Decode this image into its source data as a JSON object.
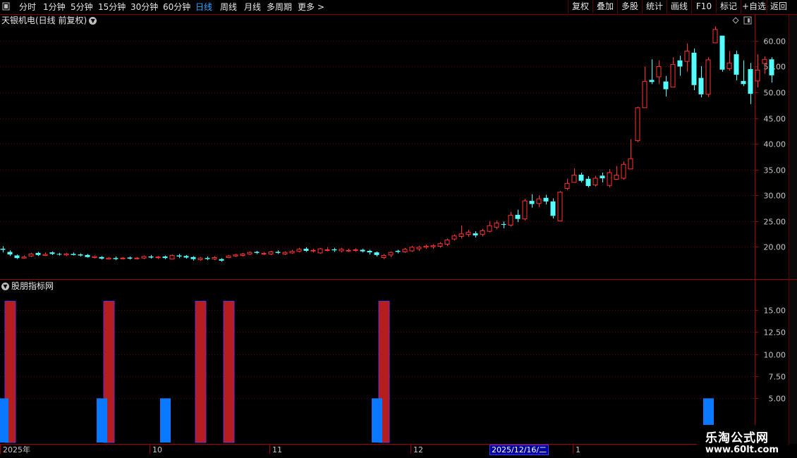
{
  "toolbar": {
    "periods": [
      "分时",
      "1分钟",
      "5分钟",
      "15分钟",
      "30分钟",
      "60分钟",
      "日线",
      "周线",
      "月线",
      "多周期",
      "更多 >"
    ],
    "active_period": "日线",
    "buttons": [
      "复权",
      "叠加",
      "多股",
      "统计",
      "画线",
      "F10",
      "标记",
      "+自选",
      "返回"
    ]
  },
  "main_chart": {
    "stock_title": "天银机电(日线 前复权)",
    "y_ticks": [
      "60.00",
      "55.00",
      "50.00",
      "45.00",
      "40.00",
      "35.00",
      "30.00",
      "25.00",
      "20.00"
    ]
  },
  "sub_chart": {
    "title": "股朋指标网",
    "y_ticks": [
      "15.00",
      "12.50",
      "10.00",
      "7.50",
      "5.00"
    ]
  },
  "x_axis": {
    "labels": [
      "2025年",
      "10",
      "11",
      "12",
      "1"
    ],
    "cursor_date": "2025/12/16/二"
  },
  "watermark": {
    "line1": "乐淘公式网",
    "line2": "www.60lt.com"
  },
  "colors": {
    "up": "#ff3232",
    "down": "#54ffff",
    "grid": "#5a0000",
    "red_bar": "#b41e1e",
    "blue_bar": "#0a78ff",
    "axis_text": "#c8c8c8"
  },
  "chart_data": [
    {
      "type": "candlestick",
      "title": "天银机电(日线 前复权)",
      "ylim": [
        14,
        63
      ],
      "candles": [
        [
          19.6,
          19.4,
          20.1,
          18.9
        ],
        [
          19.0,
          18.5,
          19.3,
          18.2
        ],
        [
          18.3,
          17.8,
          18.5,
          17.6
        ],
        [
          17.8,
          18.0,
          18.3,
          17.7
        ],
        [
          18.2,
          18.6,
          18.8,
          18.0
        ],
        [
          18.8,
          18.4,
          19.0,
          18.2
        ],
        [
          18.3,
          18.5,
          18.9,
          18.2
        ],
        [
          18.9,
          18.6,
          19.1,
          18.4
        ],
        [
          18.6,
          18.5,
          18.8,
          18.3
        ],
        [
          18.4,
          18.6,
          18.8,
          18.2
        ],
        [
          18.6,
          18.4,
          18.9,
          18.3
        ],
        [
          18.5,
          18.3,
          18.7,
          18.1
        ],
        [
          18.4,
          18.0,
          18.6,
          17.9
        ],
        [
          17.9,
          18.1,
          18.3,
          17.7
        ],
        [
          18.0,
          17.7,
          18.2,
          17.5
        ],
        [
          17.6,
          17.8,
          18.0,
          17.5
        ],
        [
          17.8,
          17.6,
          18.1,
          17.4
        ],
        [
          17.7,
          17.8,
          18.0,
          17.5
        ],
        [
          17.9,
          17.7,
          18.1,
          17.5
        ],
        [
          17.7,
          17.8,
          18.0,
          17.5
        ],
        [
          17.8,
          18.1,
          18.3,
          17.6
        ],
        [
          18.1,
          17.9,
          18.4,
          17.7
        ],
        [
          17.9,
          18.0,
          18.2,
          17.6
        ],
        [
          18.1,
          17.8,
          18.3,
          17.6
        ],
        [
          17.6,
          18.3,
          18.5,
          17.5
        ],
        [
          18.3,
          18.1,
          18.6,
          17.8
        ],
        [
          18.2,
          17.9,
          18.4,
          17.7
        ],
        [
          18.0,
          17.6,
          18.2,
          17.3
        ],
        [
          17.5,
          17.8,
          18.0,
          17.3
        ],
        [
          17.8,
          17.6,
          18.1,
          17.4
        ],
        [
          17.6,
          17.9,
          18.2,
          17.4
        ],
        [
          17.6,
          17.3,
          17.8,
          17.1
        ],
        [
          17.9,
          18.2,
          18.4,
          17.8
        ],
        [
          18.2,
          18.4,
          18.6,
          18.0
        ],
        [
          18.3,
          18.6,
          18.8,
          18.1
        ],
        [
          18.6,
          18.9,
          19.1,
          18.4
        ],
        [
          19.0,
          18.8,
          19.2,
          18.6
        ],
        [
          18.7,
          18.7,
          19.0,
          18.4
        ],
        [
          18.6,
          19.0,
          19.2,
          18.4
        ],
        [
          19.0,
          18.8,
          19.3,
          18.6
        ],
        [
          18.6,
          18.9,
          19.1,
          18.4
        ],
        [
          18.8,
          19.1,
          19.4,
          18.6
        ],
        [
          19.1,
          19.5,
          19.8,
          18.9
        ],
        [
          19.6,
          19.2,
          19.9,
          19.0
        ],
        [
          19.2,
          19.3,
          19.6,
          18.9
        ],
        [
          18.8,
          19.6,
          19.8,
          18.6
        ],
        [
          19.4,
          19.4,
          19.9,
          19.1
        ],
        [
          19.5,
          19.3,
          19.8,
          19.0
        ],
        [
          19.2,
          19.5,
          19.8,
          18.9
        ],
        [
          19.3,
          19.3,
          19.6,
          19.0
        ],
        [
          19.3,
          19.4,
          19.7,
          19.0
        ],
        [
          19.4,
          19.1,
          19.6,
          18.9
        ],
        [
          19.2,
          18.9,
          19.4,
          18.5
        ],
        [
          18.9,
          18.4,
          19.1,
          18.1
        ],
        [
          17.9,
          18.3,
          18.6,
          17.6
        ],
        [
          18.4,
          18.9,
          19.1,
          18.0
        ],
        [
          19.2,
          19.0,
          19.4,
          18.7
        ],
        [
          19.0,
          19.5,
          19.8,
          18.8
        ],
        [
          19.2,
          19.9,
          20.2,
          19.0
        ],
        [
          19.6,
          19.9,
          20.2,
          19.2
        ],
        [
          19.9,
          20.1,
          20.4,
          19.6
        ],
        [
          20.0,
          20.2,
          20.5,
          19.6
        ],
        [
          20.1,
          20.6,
          20.9,
          19.8
        ],
        [
          20.5,
          21.3,
          21.6,
          20.1
        ],
        [
          21.5,
          22.1,
          22.4,
          21.2
        ],
        [
          22.0,
          22.5,
          24.1,
          21.6
        ],
        [
          22.4,
          22.8,
          23.3,
          21.9
        ],
        [
          22.6,
          22.2,
          23.0,
          21.8
        ],
        [
          22.4,
          23.1,
          23.5,
          22.0
        ],
        [
          23.0,
          24.1,
          25.0,
          22.8
        ],
        [
          23.8,
          24.6,
          25.1,
          23.4
        ],
        [
          24.4,
          24.3,
          24.9,
          23.6
        ],
        [
          24.2,
          26.1,
          26.8,
          23.9
        ],
        [
          26.2,
          25.4,
          27.2,
          24.8
        ],
        [
          25.4,
          28.9,
          29.3,
          25.1
        ],
        [
          28.9,
          28.3,
          30.2,
          27.6
        ],
        [
          28.4,
          29.3,
          30.0,
          27.7
        ],
        [
          29.5,
          28.8,
          30.1,
          28.2
        ],
        [
          28.8,
          26.0,
          29.4,
          25.5
        ],
        [
          25.0,
          30.6,
          30.8,
          24.9
        ],
        [
          31.3,
          32.3,
          33.2,
          31.0
        ],
        [
          32.5,
          33.9,
          35.2,
          32.6
        ],
        [
          34.0,
          32.8,
          34.4,
          32.5
        ],
        [
          33.2,
          31.8,
          33.7,
          31.5
        ],
        [
          32.0,
          33.3,
          33.8,
          31.7
        ],
        [
          33.8,
          33.3,
          34.4,
          32.5
        ],
        [
          31.9,
          34.4,
          35.1,
          31.5
        ],
        [
          33.1,
          33.9,
          35.7,
          33.0
        ],
        [
          33.3,
          36.0,
          36.6,
          33.0
        ],
        [
          35.1,
          37.1,
          40.9,
          35.1
        ],
        [
          40.6,
          47.0,
          47.2,
          40.3
        ],
        [
          47.0,
          52.1,
          55.0,
          47.0
        ],
        [
          52.4,
          52.0,
          56.4,
          51.6
        ],
        [
          53.0,
          55.0,
          56.2,
          51.6
        ],
        [
          52.1,
          50.6,
          53.2,
          49.2
        ],
        [
          51.0,
          55.4,
          56.8,
          51.0
        ],
        [
          56.2,
          55.0,
          57.1,
          53.2
        ],
        [
          56.0,
          58.0,
          59.5,
          54.0
        ],
        [
          57.7,
          51.4,
          58.5,
          50.4
        ],
        [
          52.8,
          49.6,
          55.1,
          49.0
        ],
        [
          49.6,
          56.3,
          56.8,
          49.1
        ],
        [
          59.6,
          62.2,
          62.8,
          59.6
        ],
        [
          61.0,
          54.4,
          61.0,
          54.0
        ],
        [
          54.6,
          55.7,
          58.0,
          54.2
        ],
        [
          57.4,
          53.4,
          58.1,
          52.3
        ],
        [
          52.2,
          51.6,
          56.2,
          51.2
        ],
        [
          54.5,
          49.7,
          55.7,
          47.7
        ],
        [
          52.2,
          54.3,
          57.4,
          50.9
        ],
        [
          55.6,
          56.4,
          57.0,
          53.6
        ],
        [
          56.4,
          53.3,
          56.8,
          51.9
        ]
      ]
    },
    {
      "type": "bar",
      "title": "股朋指标网",
      "ylim": [
        0,
        17
      ],
      "series": [
        {
          "values": [
            [
              1,
              16
            ],
            [
              15,
              16
            ],
            [
              28,
              16
            ],
            [
              32,
              16
            ],
            [
              54,
              16
            ]
          ]
        },
        {
          "values": [
            [
              0,
              5
            ],
            [
              14,
              5
            ],
            [
              23,
              5
            ],
            [
              53,
              5
            ],
            [
              100,
              5
            ]
          ]
        }
      ]
    }
  ]
}
